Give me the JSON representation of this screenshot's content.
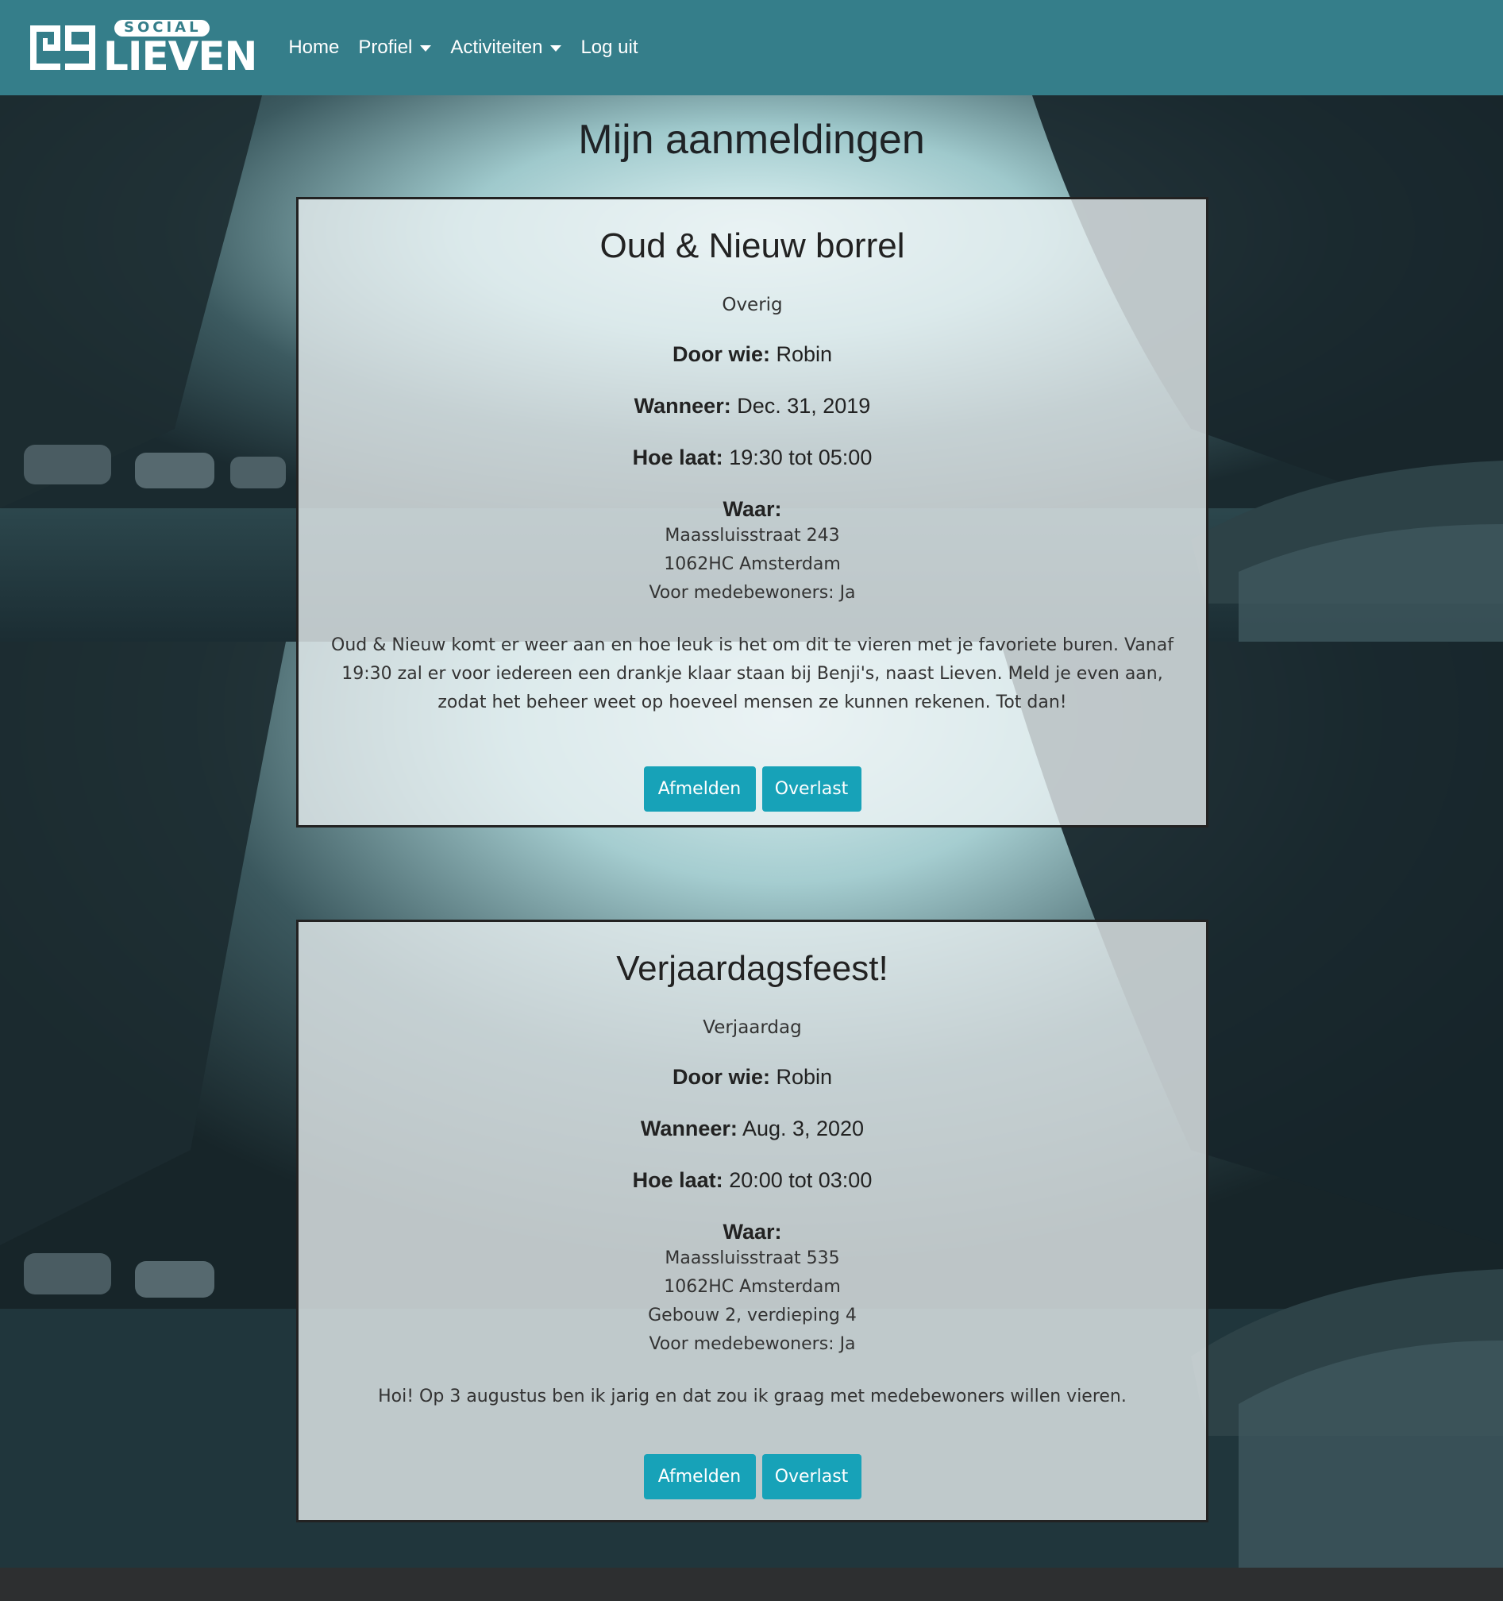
{
  "brand": {
    "social_text": "SOCIAL",
    "name": "LIEVEN"
  },
  "nav": {
    "home": "Home",
    "profiel": "Profiel",
    "activiteiten": "Activiteiten",
    "logout": "Log uit"
  },
  "page": {
    "title": "Mijn aanmeldingen"
  },
  "labels": {
    "door_wie": "Door wie:",
    "wanneer": "Wanneer:",
    "hoe_laat": "Hoe laat:",
    "waar": "Waar:"
  },
  "events": [
    {
      "title": "Oud & Nieuw borrel",
      "category": "Overig",
      "host": "Robin",
      "date": "Dec. 31, 2019",
      "time": "19:30 tot 05:00",
      "address_lines": [
        "Maassluisstraat 243",
        "1062HC Amsterdam",
        "Voor medebewoners: Ja"
      ],
      "description": "Oud & Nieuw komt er weer aan en hoe leuk is het om dit te vieren met je favoriete buren. Vanaf 19:30 zal er voor iedereen een drankje klaar staan bij Benji's, naast Lieven. Meld je even aan, zodat het beheer weet op hoeveel mensen ze kunnen rekenen. Tot dan!",
      "afmelden_label": "Afmelden",
      "overlast_label": "Overlast"
    },
    {
      "title": "Verjaardagsfeest!",
      "category": "Verjaardag",
      "host": "Robin",
      "date": "Aug. 3, 2020",
      "time": "20:00 tot 03:00",
      "address_lines": [
        "Maassluisstraat 535",
        "1062HC Amsterdam",
        "Gebouw 2, verdieping 4",
        "Voor medebewoners: Ja"
      ],
      "description": "Hoi! Op 3 augustus ben ik jarig en dat zou ik graag met medebewoners willen vieren.",
      "afmelden_label": "Afmelden",
      "overlast_label": "Overlast"
    }
  ],
  "colors": {
    "navbar": "#357e8a",
    "button": "#17a2b8",
    "footer": "#2d2f30"
  },
  "icons": {
    "dropdown": "caret-down-icon",
    "logo": "social-lieven-logo"
  }
}
